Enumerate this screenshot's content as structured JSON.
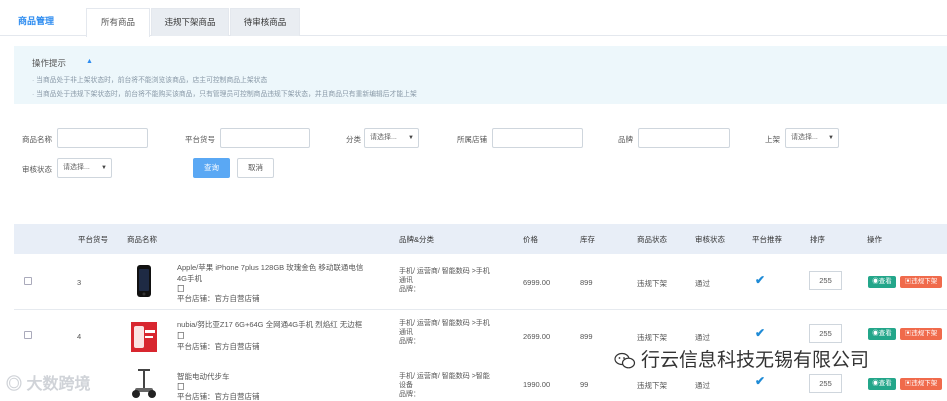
{
  "header": {
    "page_title": "商品管理",
    "tabs": [
      {
        "label": "所有商品",
        "active": true
      },
      {
        "label": "违规下架商品",
        "active": false
      },
      {
        "label": "待审核商品",
        "active": false
      }
    ]
  },
  "tips": {
    "title": "操作提示",
    "lines": [
      "· 当商品处于非上架状态时，前台将不能浏览该商品，店主可控制商品上架状态",
      "· 当商品处于违规下架状态时，前台将不能购买该商品，只有管理员可控制商品违规下架状态，并且商品只有重新编辑后才能上架"
    ]
  },
  "filters": {
    "product_name_label": "商品名称",
    "platform_sku_label": "平台货号",
    "category_label": "分类",
    "category_value": "请选择...",
    "store_label": "所属店铺",
    "brand_label": "品牌",
    "listing_label": "上架",
    "listing_value": "请选择...",
    "review_label": "审核状态",
    "review_value": "请选择...",
    "search_button": "查询",
    "cancel_button": "取消"
  },
  "table": {
    "columns": [
      "平台货号",
      "商品名称",
      "品牌&分类",
      "价格",
      "库存",
      "商品状态",
      "审核状态",
      "平台推荐",
      "排序",
      "操作"
    ],
    "rows": [
      {
        "sku": "3",
        "name_line1": "Apple/苹果 iPhone 7plus 128GB 玫瑰金色 移动联通电信",
        "name_line2": "4G手机",
        "name_line3": "囗",
        "store": "平台店铺：官方自营店铺",
        "cat_line1": "手机/ 运营商/ 智能数码 >手机",
        "cat_line2": "通讯",
        "cat_line3": "品牌：",
        "price": "6999.00",
        "stock": "899",
        "status": "违规下架",
        "review": "通过",
        "recommended": "✔",
        "sort": "255",
        "view": "查看",
        "off": "违规下架"
      },
      {
        "sku": "4",
        "name_line1": "nubia/努比亚Z17 6G+64G 全网通4G手机 烈焰红 无边框",
        "name_line2": "囗",
        "name_line3": "",
        "store": "平台店铺：官方自营店铺",
        "cat_line1": "手机/ 运营商/ 智能数码 >手机",
        "cat_line2": "通讯",
        "cat_line3": "品牌：",
        "price": "2699.00",
        "stock": "899",
        "status": "违规下架",
        "review": "通过",
        "recommended": "✔",
        "sort": "255",
        "view": "查看",
        "off": "违规下架"
      },
      {
        "sku": "",
        "name_line1": "智能电动代步车",
        "name_line2": "囗",
        "name_line3": "",
        "store": "平台店铺：官方自营店铺",
        "cat_line1": "手机/ 运营商/ 智能数码 >智能",
        "cat_line2": "设备",
        "cat_line3": "品牌：",
        "price": "1990.00",
        "stock": "99",
        "status": "违规下架",
        "review": "通过",
        "recommended": "✔",
        "sort": "255",
        "view": "查看",
        "off": "违规下架"
      }
    ]
  },
  "watermarks": {
    "left": "大数跨境",
    "right": "行云信息科技无锡有限公司"
  },
  "colors": {
    "accent": "#2d8cf0",
    "view_button": "#23a68a",
    "off_button": "#f06a4b",
    "tips_bg": "#edf7fb",
    "thead_bg": "#e8eef7"
  },
  "icons": {
    "tips_caret": "caret-up-icon",
    "select_arrow": "chevron-down-icon",
    "recommended": "checkmark-icon",
    "view": "eye-icon",
    "off": "trash-icon",
    "watermark": "wechat-icon"
  }
}
